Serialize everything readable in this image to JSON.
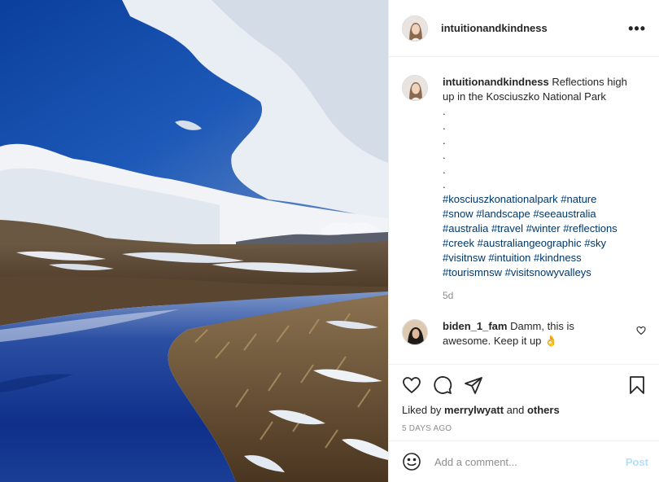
{
  "post": {
    "username": "intuitionandkindness",
    "more_label": "•••",
    "caption": {
      "username": "intuitionandkindness",
      "text": " Reflections high up in the Kosciuszko National Park",
      "dots": [
        ".",
        ".",
        ".",
        ".",
        ".",
        "."
      ],
      "hashtags": [
        "#kosciuszkonationalpark",
        "#nature",
        "#snow",
        "#landscape",
        "#seeaustralia",
        "#australia",
        "#travel",
        "#winter",
        "#reflections",
        "#creek",
        "#australiangeographic",
        "#sky",
        "#visitnsw",
        "#intuition",
        "#kindness",
        "#tourismnsw",
        "#visitsnowyvalleys"
      ],
      "age": "5d"
    },
    "comment": {
      "username": "biden_1_fam",
      "text": " Damm, this is awesome. Keep it up 👌"
    },
    "likes": {
      "prefix": "Liked by ",
      "user": "merrylwyatt",
      "and": " and ",
      "others": "others"
    },
    "timestamp": "5 DAYS AGO",
    "add_comment": {
      "placeholder": "Add a comment...",
      "post_label": "Post"
    },
    "icons": {
      "more": "more-icon",
      "like": "heart-icon",
      "comment": "comment-icon",
      "share": "share-icon",
      "save": "bookmark-icon",
      "emoji": "emoji-icon",
      "comment_like": "heart-icon"
    },
    "colors": {
      "hashtag": "#00376b",
      "muted": "#8e8e8e",
      "post_disabled": "#b2dffc"
    }
  }
}
